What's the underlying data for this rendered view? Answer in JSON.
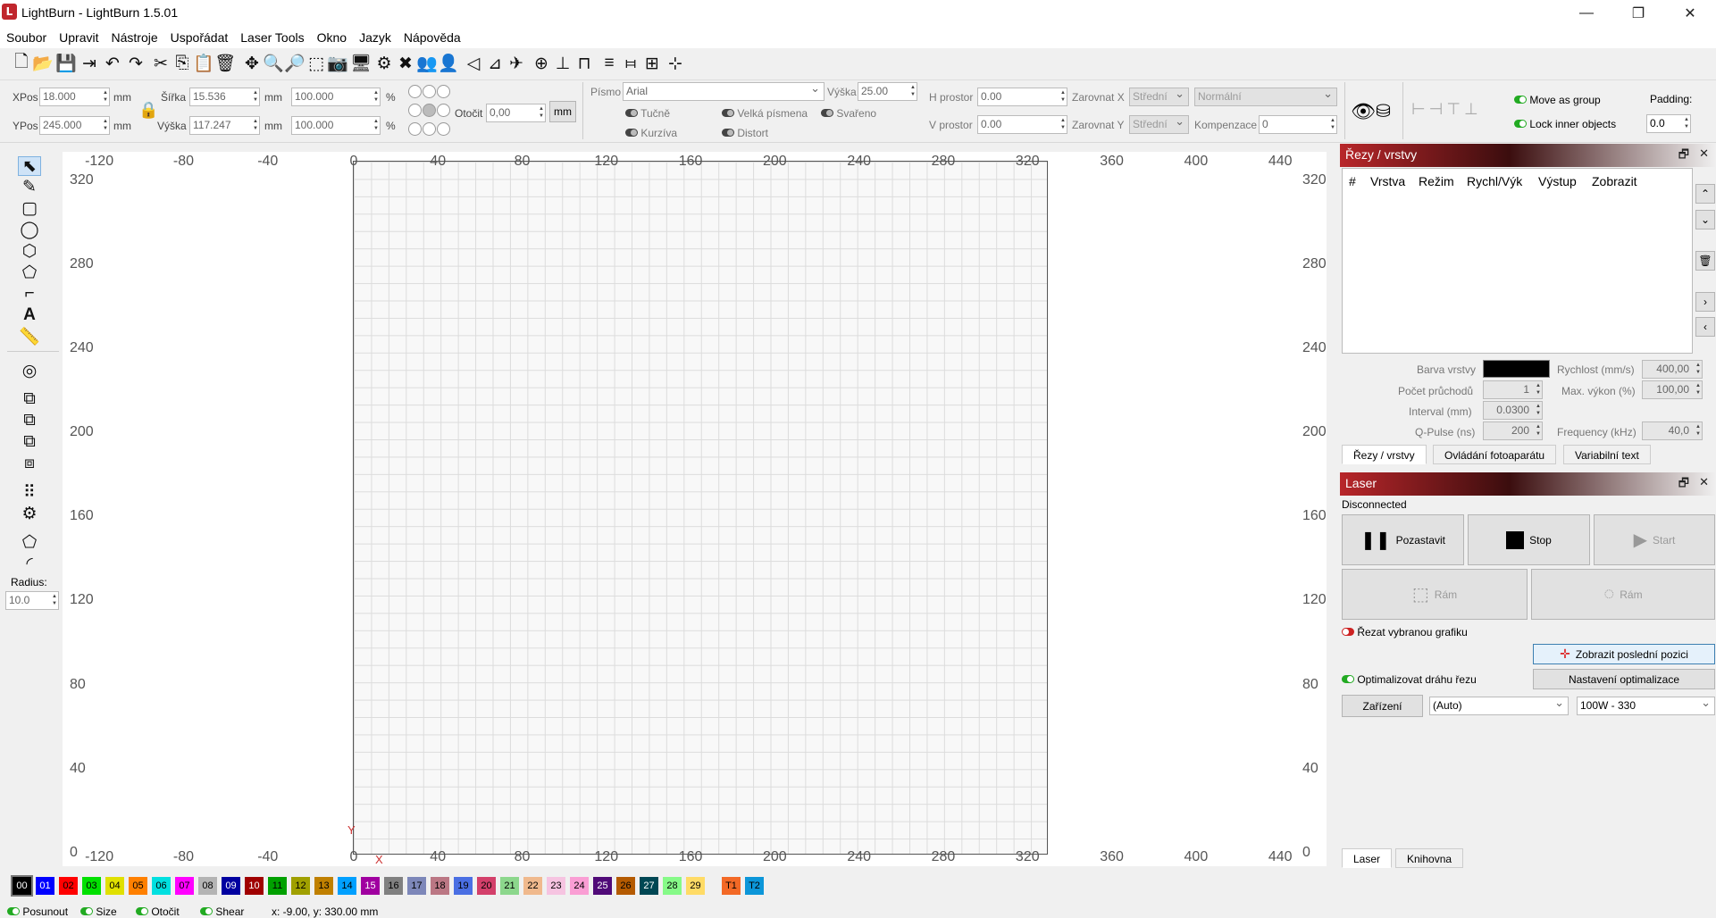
{
  "app": {
    "title": "LightBurn - LightBurn 1.5.01",
    "logo_glyph": "L"
  },
  "window_controls": {
    "minimize": "—",
    "maximize": "❐",
    "close": "✕"
  },
  "menu": [
    "Soubor",
    "Upravit",
    "Nástroje",
    "Uspořádat",
    "Laser Tools",
    "Okno",
    "Jazyk",
    "Nápověda"
  ],
  "toolbar_icons": [
    "new-file-icon",
    "open-folder-icon",
    "save-icon",
    "export-icon",
    "undo-icon",
    "redo-icon",
    "cut-icon",
    "copy-icon",
    "paste-icon",
    "delete-icon",
    "move-icon",
    "zoom-in-icon",
    "zoom-out-icon",
    "zoom-fit-icon",
    "camera-icon",
    "monitor-icon",
    "settings-icon",
    "tools-icon",
    "group-icon",
    "ungroup-icon",
    "mirror-h-icon",
    "mirror-v-icon",
    "rotate-icon",
    "align-center-icon",
    "align-icon",
    "distribute-icon",
    "distribute-v-icon",
    "align-grid-icon",
    "align-split-icon",
    "align-cross-icon"
  ],
  "toolbar_glyphs": [
    "🗋",
    "📂",
    "💾",
    "⇥",
    "↶",
    "↷",
    "✂",
    "⎘",
    "📋",
    "🗑",
    "✥",
    "🔍",
    "🔎",
    "⬚",
    "📷",
    "🖥",
    "⚙",
    "✖",
    "👥",
    "👤",
    "◁",
    "⊿",
    "✈",
    "⊕",
    "⊥",
    "⊓",
    "≡",
    "⧦",
    "⊞",
    "⊹"
  ],
  "position": {
    "xpos_label": "XPos",
    "xpos": "18.000",
    "ypos_label": "YPos",
    "ypos": "245.000",
    "mm": "mm",
    "width_label": "Šířka",
    "width": "15.536",
    "height_label": "Výška",
    "height": "117.247",
    "scale_w": "100.000",
    "scale_h": "100.000",
    "pct": "%",
    "rotate_label": "Otočit",
    "rotate": "0,00",
    "unit_button": "mm"
  },
  "text_tools": {
    "font_label": "Písmo",
    "font": "Arial",
    "height_label": "Výška",
    "height": "25.00",
    "hspace_label": "H prostor",
    "hspace": "0.00",
    "vspace_label": "V prostor",
    "vspace": "0.00",
    "alignx_label": "Zarovnat X",
    "alignx": "Střední",
    "aligny_label": "Zarovnat Y",
    "aligny": "Střední",
    "mode": "Normální",
    "comp_label": "Kompenzace",
    "comp": "0",
    "bold": "Tučně",
    "italic": "Kurzíva",
    "upper": "Velká písmena",
    "distort": "Distort",
    "welded": "Svařeno"
  },
  "group_tools": {
    "move_as_group": "Move as group",
    "lock_inner": "Lock inner objects",
    "padding_label": "Padding:",
    "padding": "0.0"
  },
  "left_tools": {
    "radius_label": "Radius:",
    "radius": "10.0"
  },
  "ruler": {
    "top": [
      "-120",
      "-80",
      "-40",
      "0",
      "40",
      "80",
      "120",
      "160",
      "200",
      "240",
      "280",
      "320",
      "360",
      "400",
      "440"
    ],
    "left": [
      "320",
      "280",
      "240",
      "200",
      "160",
      "120",
      "80",
      "40",
      "0"
    ],
    "axis_x": "X",
    "axis_y": "Y"
  },
  "cuts_panel": {
    "title": "Řezy / vrstvy",
    "columns": [
      "#",
      "Vrstva",
      "Režim",
      "Rychl/Výk",
      "Výstup",
      "Zobrazit"
    ],
    "layer_color_label": "Barva vrstvy",
    "layer_color": "#000000",
    "speed_label": "Rychlost (mm/s)",
    "speed": "400,00",
    "passes_label": "Počet průchodů",
    "passes": "1",
    "power_label": "Max. výkon (%)",
    "power": "100,00",
    "interval_label": "Interval (mm)",
    "interval": "0.0300",
    "qpulse_label": "Q-Pulse (ns)",
    "qpulse": "200",
    "freq_label": "Frequency (kHz)",
    "freq": "40,0",
    "tabs": [
      "Řezy / vrstvy",
      "Ovládání fotoaparátu",
      "Variabilní text"
    ]
  },
  "laser_panel": {
    "title": "Laser",
    "status": "Disconnected",
    "pause": "Pozastavit",
    "stop": "Stop",
    "start": "Start",
    "frame1": "Rám",
    "frame2": "Rám",
    "cut_selected": "Řezat vybranou grafiku",
    "show_last": "Zobrazit poslední pozici",
    "optimize": "Optimalizovat dráhu řezu",
    "opt_settings": "Nastavení optimalizace",
    "device_btn": "Zařízení",
    "device": "(Auto)",
    "profile": "100W - 330",
    "tabs": [
      "Laser",
      "Knihovna"
    ]
  },
  "palette": [
    {
      "l": "00",
      "c": "#000000",
      "t": "#ffffff"
    },
    {
      "l": "01",
      "c": "#0000ff",
      "t": "#ffffff"
    },
    {
      "l": "02",
      "c": "#ff0000",
      "t": "#000000"
    },
    {
      "l": "03",
      "c": "#00e000",
      "t": "#000000"
    },
    {
      "l": "04",
      "c": "#e0e000",
      "t": "#000000"
    },
    {
      "l": "05",
      "c": "#ff8000",
      "t": "#000000"
    },
    {
      "l": "06",
      "c": "#00e0e0",
      "t": "#000000"
    },
    {
      "l": "07",
      "c": "#ff00ff",
      "t": "#000000"
    },
    {
      "l": "08",
      "c": "#b4b4b4",
      "t": "#000000"
    },
    {
      "l": "09",
      "c": "#0000a0",
      "t": "#ffffff"
    },
    {
      "l": "10",
      "c": "#a00000",
      "t": "#ffffff"
    },
    {
      "l": "11",
      "c": "#00a000",
      "t": "#000000"
    },
    {
      "l": "12",
      "c": "#a0a000",
      "t": "#000000"
    },
    {
      "l": "13",
      "c": "#c08000",
      "t": "#000000"
    },
    {
      "l": "14",
      "c": "#00a0ff",
      "t": "#000000"
    },
    {
      "l": "15",
      "c": "#a000a0",
      "t": "#ffffff"
    },
    {
      "l": "16",
      "c": "#808080",
      "t": "#000000"
    },
    {
      "l": "17",
      "c": "#7d87b9",
      "t": "#000000"
    },
    {
      "l": "18",
      "c": "#bb7784",
      "t": "#000000"
    },
    {
      "l": "19",
      "c": "#4a6fe3",
      "t": "#000000"
    },
    {
      "l": "20",
      "c": "#d33f6a",
      "t": "#000000"
    },
    {
      "l": "21",
      "c": "#8cd78c",
      "t": "#000000"
    },
    {
      "l": "22",
      "c": "#f0b98d",
      "t": "#000000"
    },
    {
      "l": "23",
      "c": "#f6c4e1",
      "t": "#000000"
    },
    {
      "l": "24",
      "c": "#fa9ed4",
      "t": "#000000"
    },
    {
      "l": "25",
      "c": "#500a78",
      "t": "#ffffff"
    },
    {
      "l": "26",
      "c": "#b45a00",
      "t": "#000000"
    },
    {
      "l": "27",
      "c": "#004754",
      "t": "#ffffff"
    },
    {
      "l": "28",
      "c": "#86fa88",
      "t": "#000000"
    },
    {
      "l": "29",
      "c": "#ffdb66",
      "t": "#000000"
    },
    {
      "l": "T1",
      "c": "#f36926",
      "t": "#000000"
    },
    {
      "l": "T2",
      "c": "#0c96d9",
      "t": "#000000"
    }
  ],
  "status": {
    "move": "Posunout",
    "size": "Size",
    "rotate": "Otočit",
    "shear": "Shear",
    "coords": "x: -9.00, y: 330.00 mm"
  }
}
